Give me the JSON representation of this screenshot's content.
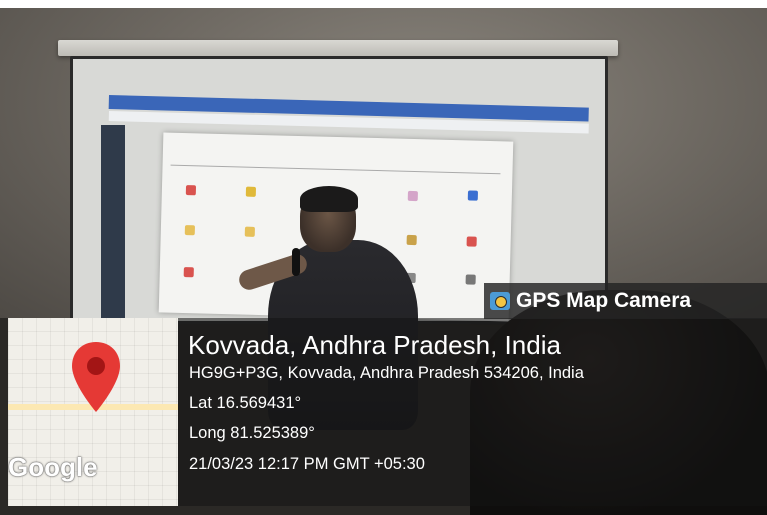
{
  "camera": {
    "badge_label": "GPS Map Camera",
    "icon": "camera-icon"
  },
  "location": {
    "title": "Kovvada, Andhra Pradesh, India",
    "address": "HG9G+P3G, Kovvada, Andhra Pradesh 534206, India",
    "lat": "Lat 16.569431°",
    "long": "Long 81.525389°",
    "timestamp": "21/03/23 12:17 PM GMT +05:30"
  },
  "map": {
    "logo": "Google",
    "pin_icon": "map-pin-icon",
    "pin_color": "#e53935"
  },
  "colors": {
    "overlay_panel": "#141414",
    "accent_blue": "#2a4fd6"
  }
}
